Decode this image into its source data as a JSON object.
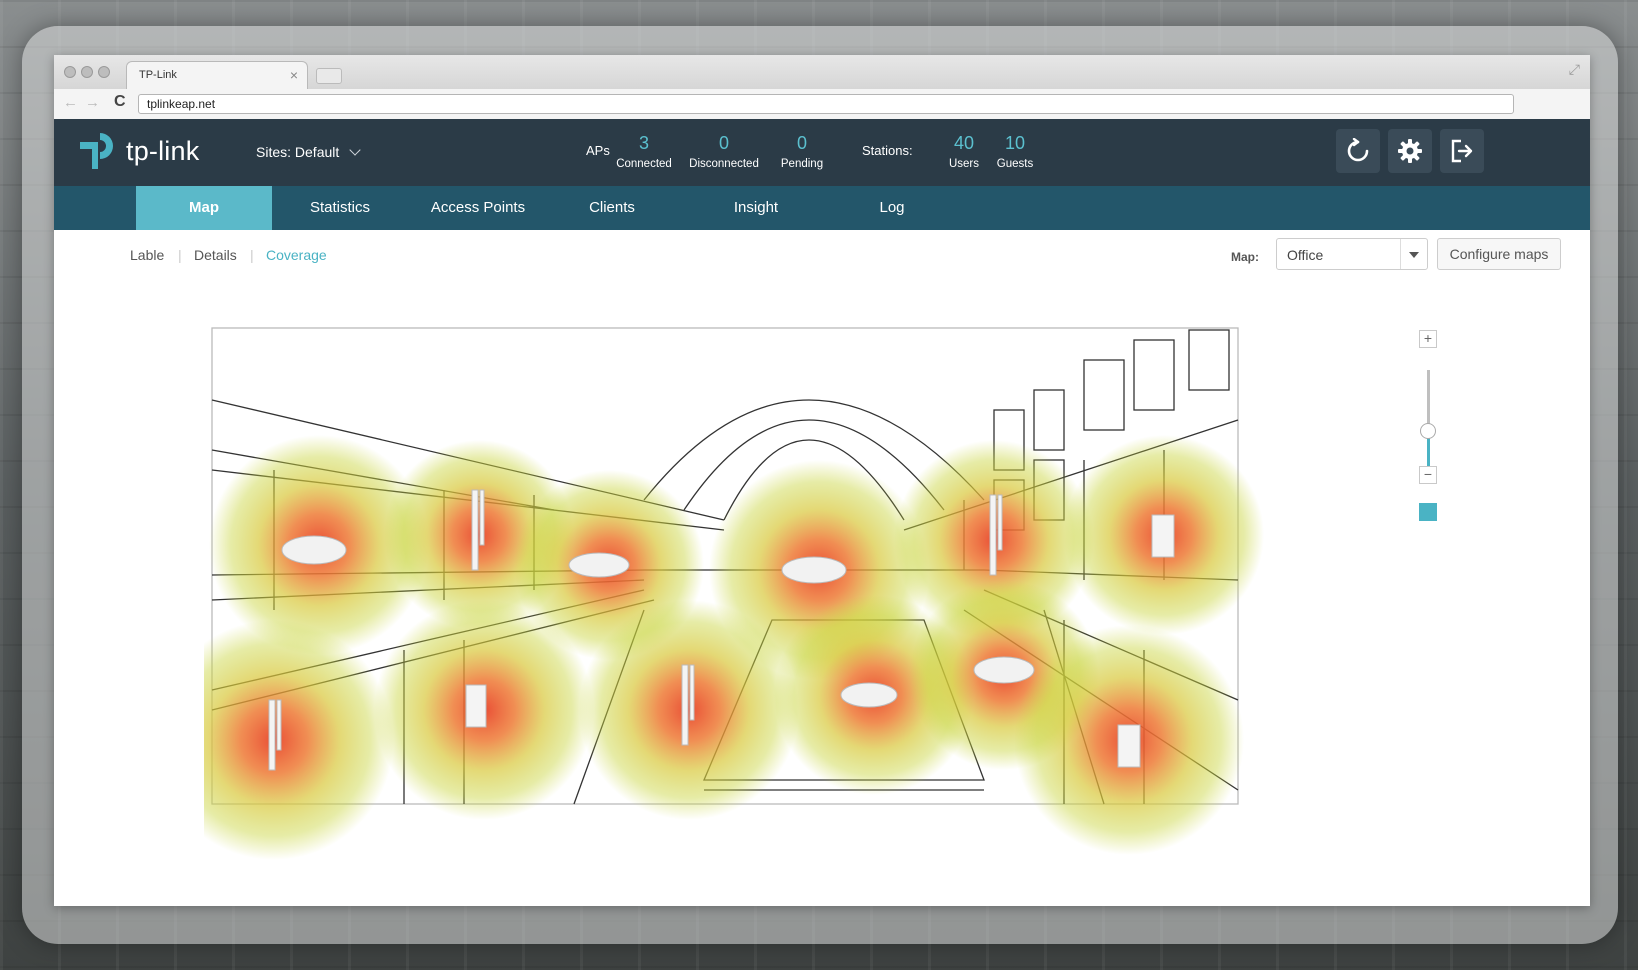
{
  "browser": {
    "tab_title": "TP-Link",
    "tab_close": "×",
    "url": "tplinkeap.net",
    "reload_glyph": "C",
    "back_glyph": "←",
    "forward_glyph": "→",
    "expand_glyph": "⤢"
  },
  "header": {
    "logo_text": "tp-link",
    "sites_label": "Sites: Default",
    "aps": {
      "label": "APs",
      "connected": "3",
      "connected_label": "Connected",
      "disconnected": "0",
      "disconnected_label": "Disconnected",
      "pending": "0",
      "pending_label": "Pending"
    },
    "stations": {
      "label": "Stations:",
      "users": "40",
      "users_label": "Users",
      "guests": "10",
      "guests_label": "Guests"
    },
    "buttons": [
      "refresh-icon",
      "gear-icon",
      "logout-icon"
    ]
  },
  "nav": {
    "tabs": [
      {
        "label": "Map",
        "active": true
      },
      {
        "label": "Statistics",
        "active": false
      },
      {
        "label": "Access Points",
        "active": false
      },
      {
        "label": "Clients",
        "active": false
      },
      {
        "label": "Insight",
        "active": false
      },
      {
        "label": "Log",
        "active": false
      }
    ]
  },
  "view": {
    "links": [
      {
        "label": "Lable",
        "active": false
      },
      {
        "label": "Details",
        "active": false
      },
      {
        "label": "Coverage",
        "active": true
      }
    ],
    "map_label": "Map:",
    "map_selected": "Office",
    "configure_label": "Configure maps"
  },
  "zoom": {
    "plus": "+",
    "minus": "−",
    "level": 0.6
  },
  "coverage": {
    "colors": {
      "hot": "#e8452b",
      "mid": "#f0a83a",
      "edge": "#c8d43a"
    },
    "access_points": [
      {
        "type": "ceiling"
      },
      {
        "type": "outdoor-antenna"
      },
      {
        "type": "ceiling"
      },
      {
        "type": "ceiling"
      },
      {
        "type": "outdoor-antenna"
      },
      {
        "type": "wall-plate"
      },
      {
        "type": "outdoor-antenna"
      },
      {
        "type": "wall-plate"
      },
      {
        "type": "outdoor-antenna"
      },
      {
        "type": "ceiling"
      },
      {
        "type": "ceiling"
      },
      {
        "type": "wall-plate"
      }
    ]
  },
  "colors": {
    "header_bg": "#2b3b47",
    "nav_bg": "#23566a",
    "accent": "#5bb9c9"
  }
}
